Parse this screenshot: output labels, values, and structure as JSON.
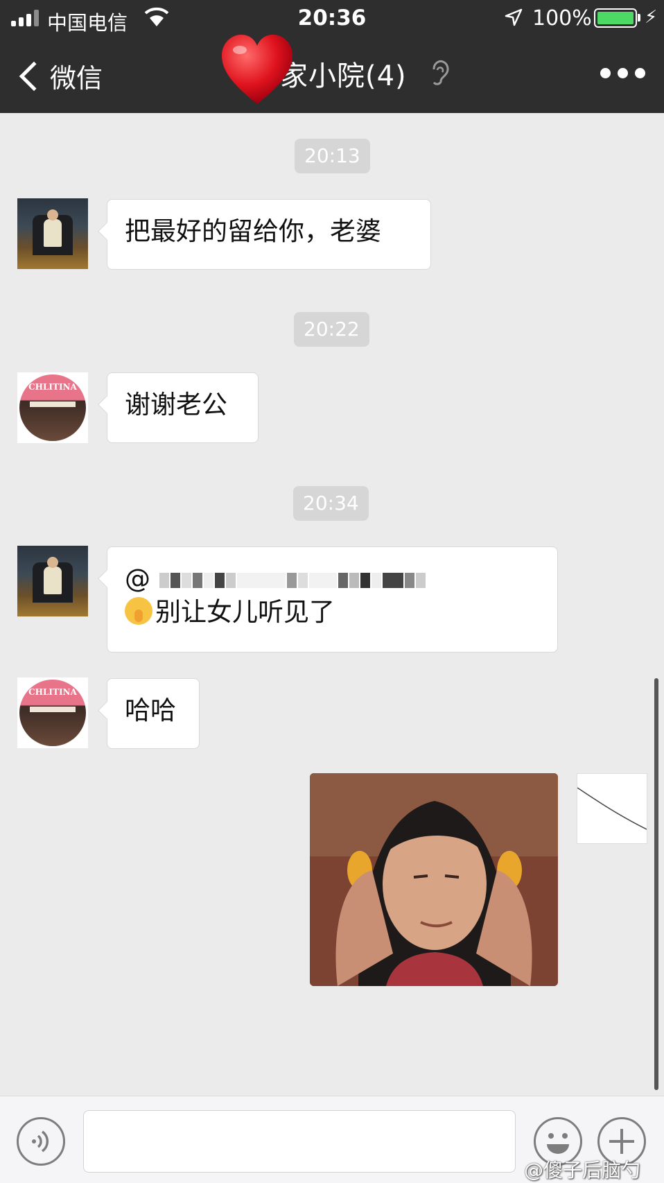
{
  "status_bar": {
    "carrier": "中国电信",
    "time": "20:36",
    "battery": "100%",
    "battery_level": 1.0
  },
  "nav": {
    "back_label": "微信",
    "title": "家小院(4)",
    "back_icon": "chevron-left-icon",
    "overlay_icon": "heart-emoji-icon",
    "ear_icon": "ear-icon",
    "more_icon": "more-dots-icon"
  },
  "messages": [
    {
      "time": "20:13"
    },
    {
      "sender": "man",
      "text": "把最好的留给你，老婆"
    },
    {
      "time": "20:22"
    },
    {
      "sender": "woman",
      "text": "谢谢老公"
    },
    {
      "time": "20:34"
    },
    {
      "sender": "man",
      "mention": "@",
      "text": "别让女儿听见了"
    },
    {
      "sender": "woman",
      "text": "哈哈"
    },
    {
      "sender": "me",
      "type": "sticker"
    }
  ],
  "woman_avatar_sign": "CHLITINA",
  "input_bar": {
    "placeholder": "",
    "voice_icon": "voice-icon",
    "emoji_icon": "emoji-icon",
    "plus_icon": "plus-icon"
  },
  "watermark": "@傻子后脑勺"
}
